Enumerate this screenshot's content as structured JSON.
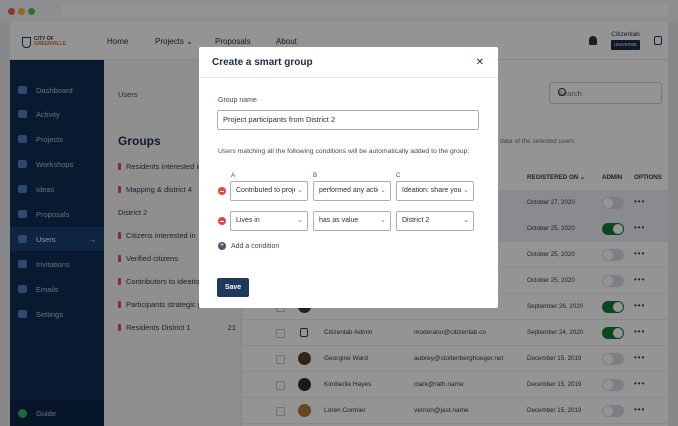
{
  "nav": {
    "logo_top": "CITY OF",
    "logo_bottom": "GREENVILLE",
    "items": [
      "Home",
      "Projects ⌄",
      "Proposals",
      "About"
    ],
    "brand": "Citizenlab",
    "brand_badge": "UNIVERSE"
  },
  "sidebar": {
    "items": [
      "Dashboard",
      "Activity",
      "Projects",
      "Workshops",
      "Ideas",
      "Proposals",
      "Users",
      "Invitations",
      "Emails",
      "Settings"
    ],
    "active_arrow": "→",
    "guide": "Guide"
  },
  "groups": {
    "breadcrumb": "Users",
    "title": "Groups",
    "items": [
      {
        "label": "Residents interested in",
        "count": ""
      },
      {
        "label": "Mapping & district 4",
        "count": ""
      },
      {
        "label": "District 2",
        "count": ""
      },
      {
        "label": "Citizens interested in",
        "count": ""
      },
      {
        "label": "Verified citizens",
        "count": ""
      },
      {
        "label": "Contributors to ideation",
        "count": ""
      },
      {
        "label": "Participants strategic p",
        "count": ""
      },
      {
        "label": "Residents District 1",
        "count": "21"
      }
    ]
  },
  "table": {
    "search_placeholder": "Search",
    "selection_hint": "data of the selected users",
    "headers": {
      "registered": "REGISTERED ON ⌄",
      "admin": "ADMIN",
      "options": "OPTIONS"
    },
    "more": "•••",
    "rows": [
      {
        "name": "",
        "email": "",
        "date": "October 27, 2020",
        "admin": false,
        "highlight": true
      },
      {
        "name": "",
        "email": "",
        "date": "October 25, 2020",
        "admin": true,
        "highlight": true
      },
      {
        "name": "",
        "email": "",
        "date": "October 25, 2020",
        "admin": false,
        "highlight": false
      },
      {
        "name": "",
        "email": "",
        "date": "October 25, 2020",
        "admin": false,
        "highlight": false
      },
      {
        "name": "",
        "email": "",
        "date": "September 26, 2020",
        "admin": true,
        "highlight": false
      },
      {
        "name": "Citizenlab Admin",
        "email": "moderator@citizenlab.co",
        "date": "September 24, 2020",
        "admin": true,
        "highlight": false
      },
      {
        "name": "Georgine Ward",
        "email": "aubrey@stoltenberghoeger.net",
        "date": "December 15, 2019",
        "admin": false,
        "highlight": false
      },
      {
        "name": "Kimberlie Hayes",
        "email": "clark@rath.name",
        "date": "December 15, 2019",
        "admin": false,
        "highlight": false
      },
      {
        "name": "Loren Cormier",
        "email": "vernon@jast.name",
        "date": "December 15, 2019",
        "admin": false,
        "highlight": false
      }
    ]
  },
  "modal": {
    "title": "Create a smart group",
    "close": "✕",
    "group_name_label": "Group name",
    "group_name_value": "Project participants from District 2",
    "description": "Users matching all the following conditions will be automatically added to the group:",
    "columns": [
      "A",
      "B",
      "C"
    ],
    "conditions": [
      {
        "a": "Contributed to project",
        "b": "performed any action",
        "c": "Ideation: share your"
      },
      {
        "a": "Lives in",
        "b": "has as value",
        "c": "District 2"
      }
    ],
    "chevron": "⌄",
    "add_condition": "Add a condition",
    "add_icon": "+",
    "save": "Save"
  },
  "colors": {
    "sidebar": "#0e2d54",
    "toggle_on": "#127a35",
    "remove": "#e0473f",
    "save": "#1d3a5c"
  }
}
